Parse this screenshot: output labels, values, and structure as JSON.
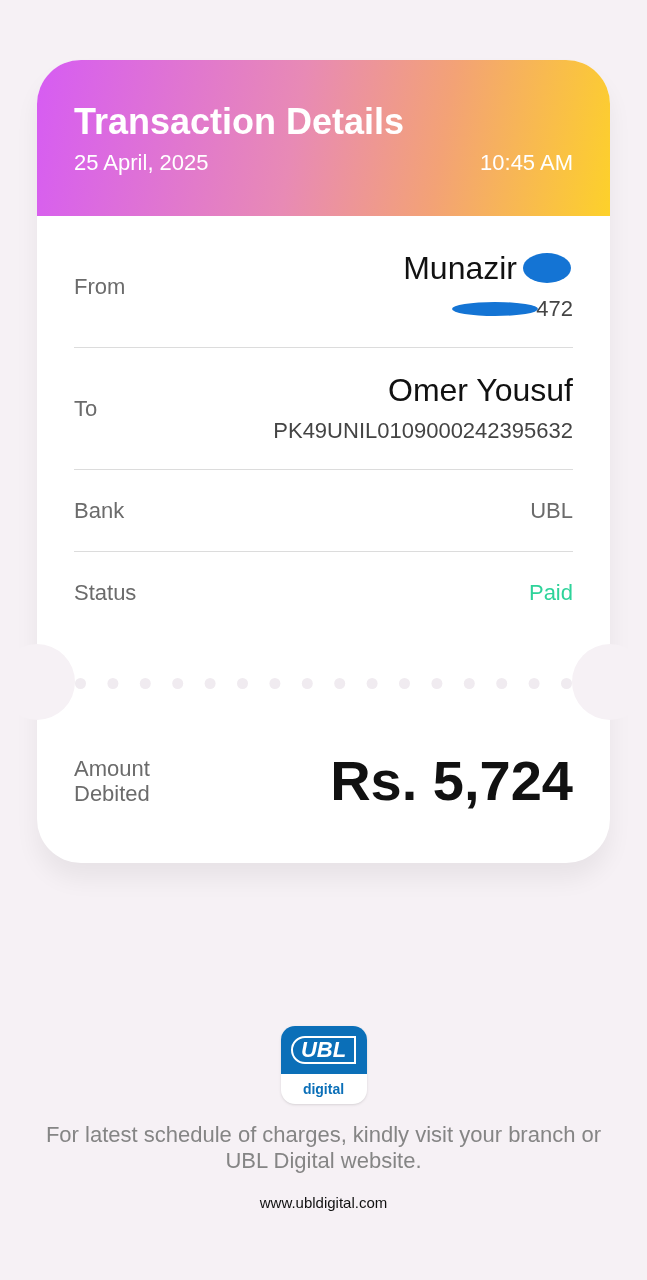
{
  "header": {
    "title": "Transaction Details",
    "date": "25 April, 2025",
    "time": "10:45 AM"
  },
  "details": [
    {
      "kind": "party",
      "label": "From",
      "name": "Munazir",
      "account": "472",
      "redacted": true
    },
    {
      "kind": "party",
      "label": "To",
      "name": "Omer Yousuf",
      "account": "PK49UNIL0109000242395632",
      "redacted": false
    },
    {
      "kind": "plain",
      "label": "Bank",
      "value": "UBL"
    },
    {
      "kind": "status",
      "label": "Status",
      "value": "Paid"
    }
  ],
  "amount": {
    "label": "Amount Debited",
    "value": "Rs. 5,724"
  },
  "logo": {
    "mark": "UBL",
    "caption": "digital"
  },
  "footer": {
    "note": "For latest schedule of charges, kindly visit your branch or UBL Digital website.",
    "url": "www.ubldigital.com"
  }
}
